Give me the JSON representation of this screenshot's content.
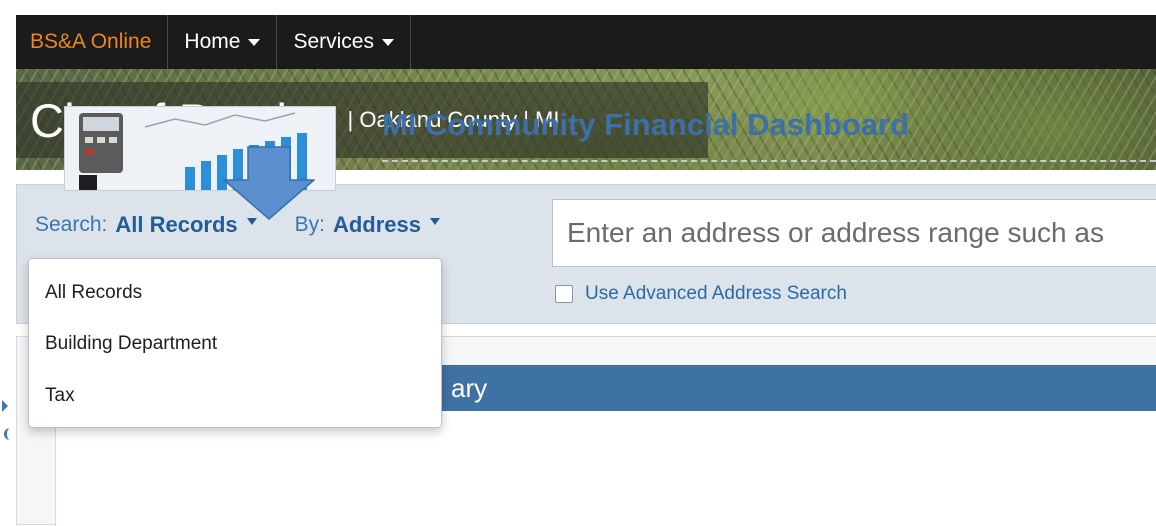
{
  "nav": {
    "brand": "BS&A Online",
    "items": [
      {
        "label": "Home"
      },
      {
        "label": "Services"
      }
    ]
  },
  "banner": {
    "city": "City of Pontiac",
    "subtitle": "| Oakland County | MI"
  },
  "search": {
    "search_label": "Search:",
    "search_value": "All Records",
    "by_label": "By:",
    "by_value": "Address",
    "input_placeholder": "Enter an address or address range such as",
    "advanced_label": "Use Advanced Address Search"
  },
  "dropdown": {
    "options": [
      "All Records",
      "Building Department",
      "Tax"
    ]
  },
  "summary": {
    "title": "ary"
  },
  "card": {
    "title": "MI Community Financial Dashboard"
  },
  "colors": {
    "accent": "#3f72a4",
    "brand_orange": "#f0851f",
    "annotation_arrow": "#5b8fcf"
  }
}
